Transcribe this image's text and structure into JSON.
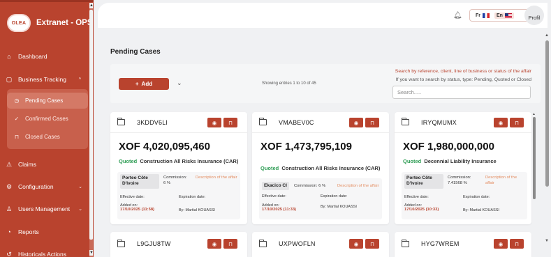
{
  "app": {
    "logo_text": "OLEA",
    "title": "Extranet - OPS"
  },
  "sidebar": {
    "items": [
      {
        "label": "Dashboard",
        "icon": "home-icon"
      },
      {
        "label": "Business Tracking",
        "icon": "clipboard-icon"
      },
      {
        "label": "Claims",
        "icon": "warning-icon"
      },
      {
        "label": "Configuration",
        "icon": "gear-icon"
      },
      {
        "label": "Users Management",
        "icon": "user-icon"
      },
      {
        "label": "Reports",
        "icon": "chart-icon"
      },
      {
        "label": "Historicals Actions",
        "icon": "history-icon"
      }
    ],
    "subitems": [
      {
        "label": "Pending Cases",
        "icon": "clock-icon"
      },
      {
        "label": "Confirmed Cases",
        "icon": "check-icon"
      },
      {
        "label": "Closed Cases",
        "icon": "lock-icon"
      }
    ]
  },
  "topbar": {
    "lang_fr": "Fr",
    "lang_en": "En",
    "profile_label": "Profil"
  },
  "page": {
    "title": "Pending Cases",
    "add_label": "Add",
    "entries_text": "Showing entries 1 to 10 of 45",
    "search_hint": "Search by reference, client, line of business or status of the affair",
    "search_sub": "If you want to search by status, type: Pending, Quoted or Closed",
    "search_placeholder": "Search....."
  },
  "cards": [
    {
      "ref": "3KDDV6LI",
      "amount": "XOF 4,020,095,460",
      "status": "Quoted",
      "lob": "Construction All Risks Insurance (CAR)",
      "insurer": "Porteo Côte D'Ivoire",
      "commission_label": "Commission:",
      "commission": "6 %",
      "desc": "Description of the affair",
      "effective_label": "Effective date:",
      "expiration_label": "Expiration date:",
      "added_label": "Added on:",
      "added": "17/10/2025 (11:58)",
      "by": "By: Martial KOUASSI"
    },
    {
      "ref": "VMABEV0C",
      "amount": "XOF 1,473,795,109",
      "status": "Quoted",
      "lob": "Construction All Risks Insurance (CAR)",
      "insurer": "Ekacico CI",
      "commission_label": "Commission:",
      "commission": "6 %",
      "desc": "Description of the affair",
      "effective_label": "Effective date:",
      "expiration_label": "Expiration date:",
      "added_label": "Added on:",
      "added": "17/10/2025 (11:33)",
      "by": "By: Martial KOUASSI"
    },
    {
      "ref": "IRYQMUMX",
      "amount": "XOF 1,980,000,000",
      "status": "Quoted",
      "lob": "Decennial Liability Insurance",
      "insurer": "Porteo Côte D'Ivoire",
      "commission_label": "Commission:",
      "commission": "7.41568 %",
      "desc": "Description of the affair",
      "effective_label": "Effective date:",
      "expiration_label": "Expiration date:",
      "added_label": "Added on:",
      "added": "17/10/2025 (10:33)",
      "by": "By: Martial KOUASSI"
    },
    {
      "ref": "L9GJU8TW"
    },
    {
      "ref": "UXPWOFLN"
    },
    {
      "ref": "HYG7WREM"
    }
  ]
}
